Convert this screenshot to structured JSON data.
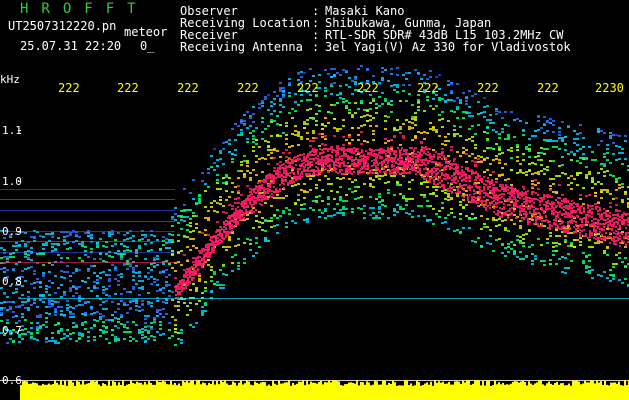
{
  "header": {
    "app_title": "HROFFT",
    "filename": "UT2507312220.pn",
    "type_label": "meteor",
    "datetime": "25.07.31 22:20",
    "step_label": "0_",
    "info": [
      {
        "label": "Observer",
        "value": "Masaki Kano"
      },
      {
        "label": "Receiving Location",
        "value": "Shibukawa, Gunma, Japan"
      },
      {
        "label": "Receiver",
        "value": "RTL-SDR SDR# 43dB L15 103.2MHz CW"
      },
      {
        "label": "Receiving Antenna",
        "value": "3el Yagi(V) Az 330 for Vladivostok"
      }
    ]
  },
  "axes": {
    "y_unit": "kHz",
    "x_ticks": [
      "222",
      "222",
      "222",
      "222",
      "222",
      "222",
      "222",
      "222",
      "222",
      "2230"
    ],
    "y_ticks": [
      "1.1",
      "1.0",
      "0.9",
      "0.8",
      "0.7",
      "0.6"
    ]
  },
  "colors": {
    "background": "#000000",
    "title_green": "#33cc33",
    "tick_yellow": "#ffff00",
    "signal_pink": "#ff1a66",
    "noise_blue": "#1e3cff",
    "level_yellow": "#ffff00"
  }
}
